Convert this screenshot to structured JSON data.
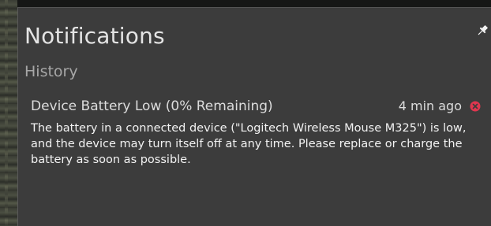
{
  "panel": {
    "title": "Notifications",
    "section_label": "History"
  },
  "icons": {
    "pin": "pin-icon",
    "close": "close-icon"
  },
  "notifications": [
    {
      "title": "Device Battery Low (0% Remaining)",
      "time": "4 min ago",
      "body": "The battery in a connected device (\"Logitech Wireless Mouse M325\") is low, and the device may turn itself off at any time. Please replace or charge the battery as soon as possible."
    }
  ],
  "colors": {
    "panel_background": "#3c3c3c",
    "close_icon": "#e0364f",
    "title_text": "#e4e4e4",
    "secondary_text": "#a7a7a7"
  }
}
